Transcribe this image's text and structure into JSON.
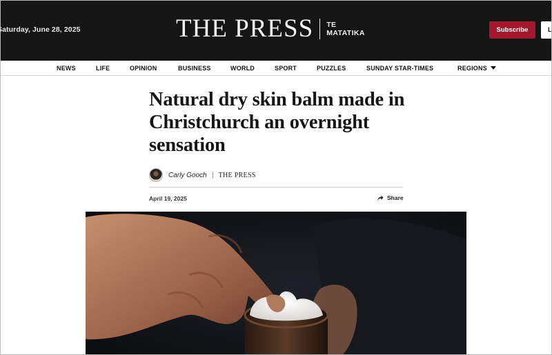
{
  "header": {
    "date": "Saturday, June 28, 2025",
    "logo_main": "THE PRESS",
    "logo_sub_line1": "TE",
    "logo_sub_line2": "MATATIKA",
    "subscribe_label": "Subscribe",
    "login_label": "L"
  },
  "nav": {
    "items": [
      "NEWS",
      "LIFE",
      "OPINION",
      "BUSINESS",
      "WORLD",
      "SPORT",
      "PUZZLES",
      "SUNDAY STAR-TIMES",
      "REGIONS"
    ]
  },
  "article": {
    "headline": "Natural dry skin balm made in Christchurch an overnight sensation",
    "author": "Carly Gooch",
    "publication": "THE PRESS",
    "date": "April 19, 2025",
    "share_label": "Share"
  },
  "colors": {
    "header_bg": "#151515",
    "subscribe_bg": "#a3182d"
  }
}
